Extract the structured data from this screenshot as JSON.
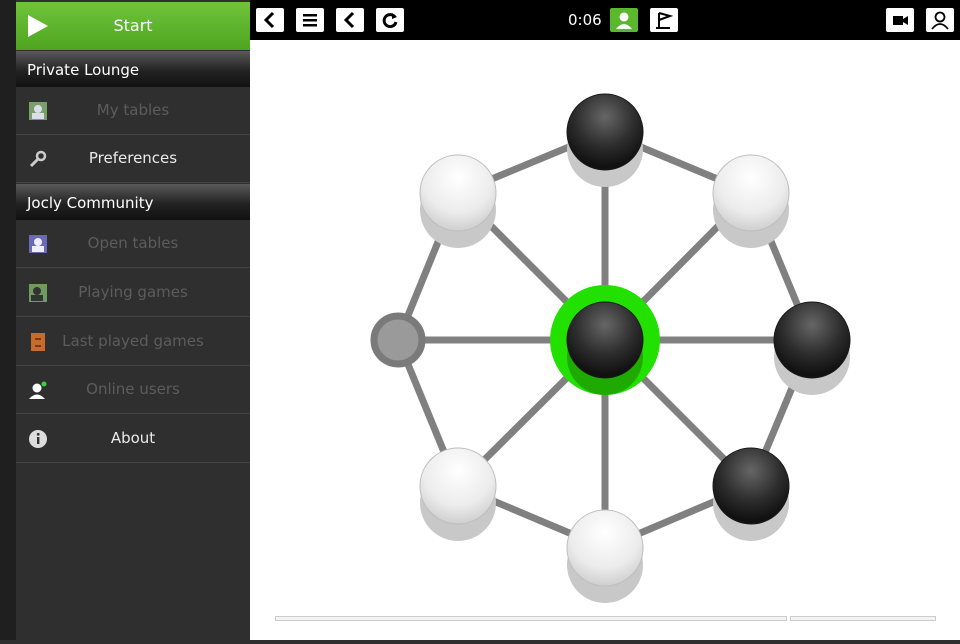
{
  "sidebar": {
    "start_label": "Start",
    "sections": [
      "Private Lounge",
      "Jocly Community"
    ],
    "items": [
      {
        "label": "My tables",
        "icon": "tables-icon",
        "active": false
      },
      {
        "label": "Preferences",
        "icon": "wrench-icon",
        "active": true
      },
      {
        "label": "Open tables",
        "icon": "open-tables-icon",
        "active": false
      },
      {
        "label": "Playing games",
        "icon": "playing-icon",
        "active": false
      },
      {
        "label": "Last played games",
        "icon": "cabinet-icon",
        "active": false
      },
      {
        "label": "Online users",
        "icon": "user-online-icon",
        "active": false
      },
      {
        "label": "About",
        "icon": "info-icon",
        "active": true
      }
    ]
  },
  "topbar": {
    "timer": "0:06",
    "buttons": [
      "back-icon",
      "menu-icon",
      "undo-icon",
      "restart-icon",
      "player-icon",
      "flag-icon",
      "camera-icon",
      "user-icon"
    ]
  },
  "board": {
    "colors": {
      "highlight": "#22e000",
      "accent": "#5cb82b"
    },
    "pieces": [
      {
        "pos": "top",
        "color": "black"
      },
      {
        "pos": "top-right",
        "color": "white"
      },
      {
        "pos": "right",
        "color": "black"
      },
      {
        "pos": "bottom-right",
        "color": "black"
      },
      {
        "pos": "bottom",
        "color": "white"
      },
      {
        "pos": "bottom-left",
        "color": "white"
      },
      {
        "pos": "left",
        "color": "empty"
      },
      {
        "pos": "top-left",
        "color": "white"
      },
      {
        "pos": "center",
        "color": "black",
        "selected": true
      }
    ]
  }
}
